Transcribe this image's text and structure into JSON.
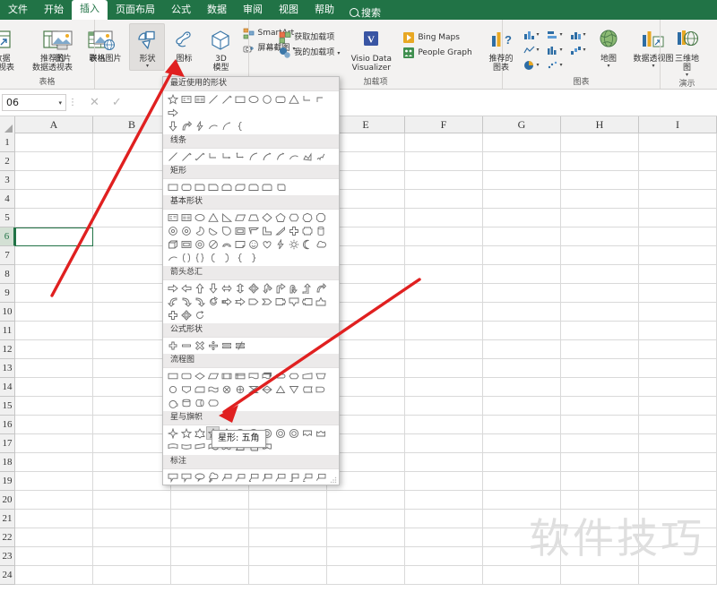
{
  "app": {
    "accent": "#217346",
    "watermark": "软件技巧"
  },
  "tabs": [
    {
      "label": "文件",
      "active": false
    },
    {
      "label": "开始",
      "active": false
    },
    {
      "label": "插入",
      "active": true
    },
    {
      "label": "页面布局",
      "active": false
    },
    {
      "label": "公式",
      "active": false
    },
    {
      "label": "数据",
      "active": false
    },
    {
      "label": "审阅",
      "active": false
    },
    {
      "label": "视图",
      "active": false
    },
    {
      "label": "帮助",
      "active": false
    }
  ],
  "search": {
    "label": "搜索",
    "icon": "search-icon"
  },
  "ribbon": {
    "groups": [
      {
        "label": "表格",
        "buttons": [
          {
            "label": "数据\n透视表",
            "icon": "pivot-table-icon"
          },
          {
            "label": "推荐的\n数据透视表",
            "icon": "recommended-pivot-icon"
          },
          {
            "label": "表格",
            "icon": "table-icon"
          }
        ]
      },
      {
        "label": "",
        "buttons": [
          {
            "label": "图片",
            "icon": "picture-icon"
          },
          {
            "label": "联机图片",
            "icon": "online-picture-icon"
          },
          {
            "label": "形状",
            "icon": "shapes-icon",
            "active": true,
            "caret": "▾"
          },
          {
            "label": "图标",
            "icon": "icons-icon"
          },
          {
            "label": "3D\n模型",
            "icon": "3d-model-icon",
            "caret": "▾"
          }
        ],
        "small": [
          {
            "label": "SmartArt",
            "icon": "smartart-icon"
          },
          {
            "label": "屏幕截图",
            "icon": "screenshot-icon",
            "caret": "▾"
          }
        ]
      },
      {
        "label": "加载项",
        "small": [
          {
            "label": "获取加载项",
            "icon": "get-addins-icon"
          },
          {
            "label": "我的加载项",
            "icon": "my-addins-icon",
            "caret": "▾"
          }
        ],
        "buttons": [
          {
            "label": "Visio Data\nVisualizer",
            "icon": "visio-icon"
          }
        ],
        "small2": [
          {
            "label": "Bing Maps",
            "icon": "bing-maps-icon"
          },
          {
            "label": "People Graph",
            "icon": "people-graph-icon"
          }
        ]
      },
      {
        "label": "图表",
        "dialog_launcher": true,
        "buttons": [
          {
            "label": "推荐的\n图表",
            "icon": "recommended-charts-icon"
          },
          {
            "label": "地图",
            "icon": "map-icon",
            "caret": "▾"
          },
          {
            "label": "数据透视图",
            "icon": "pivot-chart-icon",
            "caret": "▾"
          }
        ],
        "chart_icons": [
          {
            "icon": "column-chart-icon"
          },
          {
            "icon": "bar-chart-icon"
          },
          {
            "icon": "hierarchy-chart-icon"
          },
          {
            "icon": "line-chart-icon"
          },
          {
            "icon": "statistic-chart-icon"
          },
          {
            "icon": "waterfall-chart-icon"
          },
          {
            "icon": "pie-chart-icon"
          },
          {
            "icon": "scatter-chart-icon"
          }
        ]
      },
      {
        "label": "演示",
        "buttons": [
          {
            "label": "三维地\n图",
            "icon": "3d-map-icon",
            "caret": "▾"
          }
        ]
      }
    ]
  },
  "formula_bar": {
    "name_box_value": "06",
    "name_box_caret": "▾",
    "cancel_icon": "close-icon",
    "confirm_icon": "check-icon",
    "fx_icon": "function-icon",
    "formula_value": "",
    "formula_placeholder": ""
  },
  "grid": {
    "columns": [
      "A",
      "B",
      "C",
      "D",
      "E",
      "F",
      "G",
      "H",
      "I"
    ],
    "rows": [
      "1",
      "2",
      "3",
      "4",
      "5",
      "6",
      "7",
      "8",
      "9",
      "10",
      "11",
      "12",
      "13",
      "14",
      "15",
      "16",
      "17",
      "18",
      "19",
      "20",
      "21",
      "22",
      "23",
      "24"
    ],
    "selected_row": "6",
    "active_cell": {
      "col": "A",
      "row": "6"
    }
  },
  "shapes_gallery": {
    "sections": [
      {
        "title": "最近使用的形状",
        "rows": [
          [
            "star5",
            "textbox",
            "textbox2",
            "line",
            "line-arrow",
            "rect",
            "oval",
            "circle",
            "round-rect",
            "triangle",
            "elbow",
            "elbow2",
            "arrow-right"
          ],
          [
            "arrow-down",
            "arrow-curve",
            "lightning",
            "arc",
            "curve",
            "brace-left"
          ]
        ]
      },
      {
        "title": "线条",
        "rows": [
          [
            "line",
            "line-arrow",
            "line-double-arrow",
            "elbow",
            "elbow-arrow",
            "elbow-double",
            "curve",
            "curve-arrow",
            "curve-double",
            "arc",
            "freeform",
            "scribble"
          ]
        ]
      },
      {
        "title": "矩形",
        "rows": [
          [
            "rect",
            "round-rect",
            "round1-rect",
            "snip1-rect",
            "snip2-same-rect",
            "snip2-diag-rect",
            "snip-round-rect",
            "round2-same-rect",
            "round2-diag-rect"
          ]
        ]
      },
      {
        "title": "基本形状",
        "rows": [
          [
            "textbox",
            "textbox2",
            "oval",
            "triangle",
            "right-triangle",
            "parallelogram",
            "trapezoid",
            "diamond",
            "pentagon",
            "hexagon",
            "heptagon",
            "octagon"
          ],
          [
            "decagon",
            "dodecagon",
            "pie",
            "chord",
            "teardrop",
            "frame",
            "half-frame",
            "corner",
            "diag-stripe",
            "cross",
            "plaque",
            "can"
          ],
          [
            "cube",
            "bevel",
            "donut",
            "no-symbol",
            "block-arc",
            "folded-corner",
            "smiley",
            "heart",
            "lightning",
            "sun",
            "moon",
            "cloud"
          ],
          [
            "arc",
            "bracket-pair",
            "brace-pair",
            "bracket-left",
            "bracket-right",
            "brace-left",
            "brace-right"
          ]
        ]
      },
      {
        "title": "箭头总汇",
        "rows": [
          [
            "arrow-right",
            "arrow-left",
            "arrow-up",
            "arrow-down",
            "arrow-lr",
            "arrow-ud",
            "arrow-quad",
            "arrow-tri",
            "bent-arrow",
            "u-turn-arrow",
            "bent-up-arrow",
            "curved-up"
          ],
          [
            "curved-left",
            "curved-right",
            "curved-down",
            "circular",
            "striped-right",
            "notched-right",
            "pentagon-arrow",
            "chevron",
            "right-callout",
            "down-callout",
            "left-callout",
            "up-callout"
          ],
          [
            "cross-arrow",
            "quad-callout",
            "circular-arrow"
          ]
        ]
      },
      {
        "title": "公式形状",
        "rows": [
          [
            "plus",
            "minus",
            "multiply",
            "divide",
            "equal",
            "not-equal"
          ]
        ]
      },
      {
        "title": "流程图",
        "rows": [
          [
            "fc-process",
            "fc-alt-process",
            "fc-decision",
            "fc-data",
            "fc-predefined",
            "fc-internal-storage",
            "fc-document",
            "fc-multidoc",
            "fc-terminator",
            "fc-preparation",
            "fc-manual-input",
            "fc-manual-operation"
          ],
          [
            "fc-connector",
            "fc-off-page",
            "fc-card",
            "fc-punched-tape",
            "fc-summing",
            "fc-or",
            "fc-collate",
            "fc-sort",
            "fc-extract",
            "fc-merge",
            "fc-stored-data",
            "fc-delay"
          ],
          [
            "fc-sequential",
            "fc-magnetic-disk",
            "fc-direct-access",
            "fc-display"
          ]
        ]
      },
      {
        "title": "星与旗帜",
        "rows": [
          [
            "star4",
            "star5",
            "star6",
            "star5-selected",
            "star7",
            "star10",
            "star12",
            "star16",
            "star24",
            "star32",
            "ribbon-up",
            "ribbon-down"
          ],
          [
            "ribbon-curved",
            "ribbon-curved2",
            "ribbon-tilted",
            "wave",
            "double-wave",
            "scroll-h",
            "scroll-v",
            "banner"
          ]
        ]
      },
      {
        "title": "标注",
        "rows": [
          [
            "callout-rect",
            "callout-round",
            "callout-oval",
            "callout-cloud",
            "callout-line1",
            "callout-line2",
            "callout-line1-border",
            "callout-accent1",
            "callout-accent2",
            "callout-accent-bar1",
            "callout-accent-bar2",
            "callout-bar1"
          ],
          [
            "callout-bar2",
            "callout-bar3",
            "callout-bar4",
            "callout-bar5"
          ]
        ]
      }
    ],
    "selected_shape_index": {
      "section": 7,
      "row": 0,
      "item": 3
    },
    "resize_grip": "resize-grip-icon"
  },
  "tooltip": {
    "text": "星形: 五角"
  },
  "annotations": [
    {
      "name": "arrow-to-shapes-button",
      "color": "#e02020"
    },
    {
      "name": "arrow-to-star-shape",
      "color": "#e02020"
    }
  ]
}
